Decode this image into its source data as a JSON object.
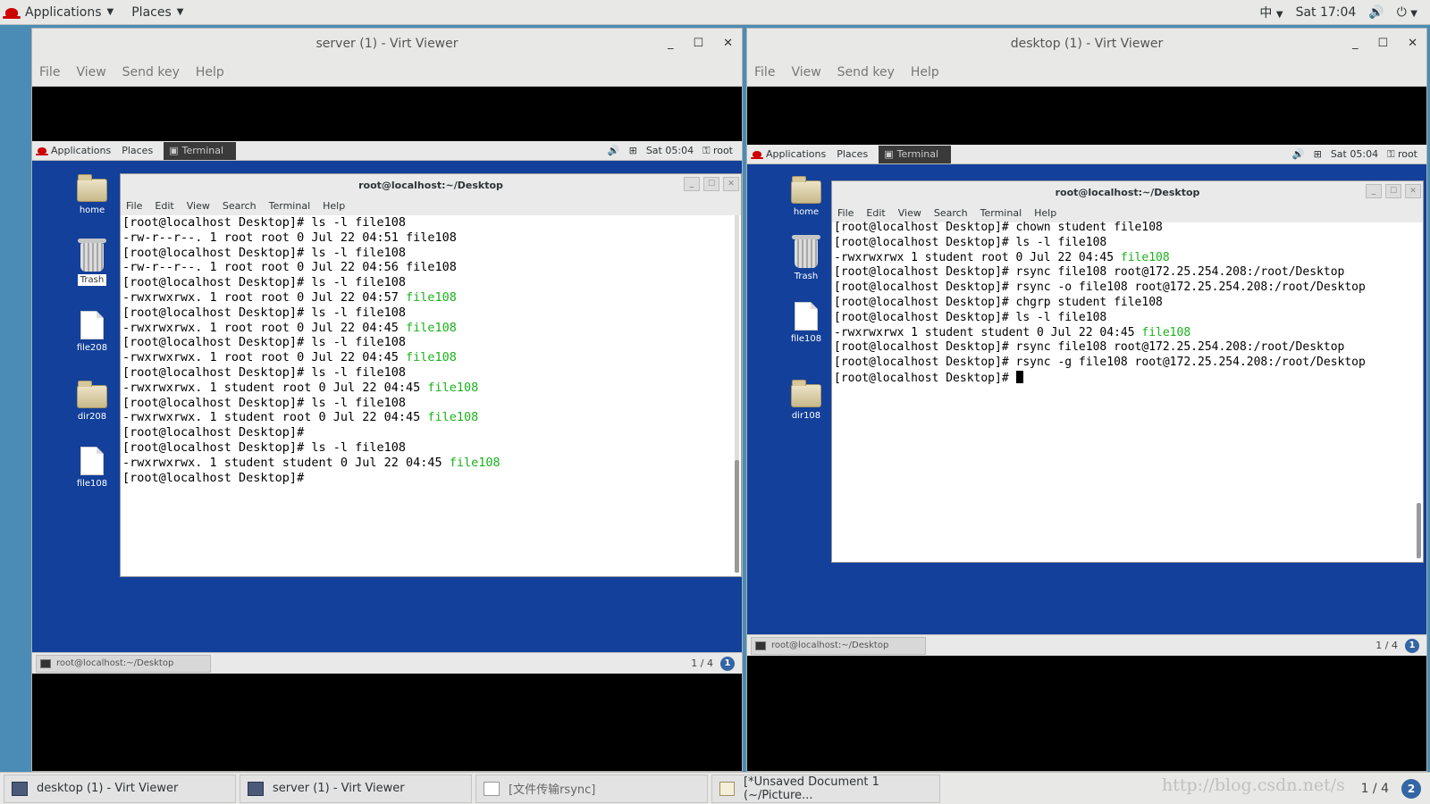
{
  "host_topbar": {
    "applications": "Applications",
    "places": "Places",
    "input_method": "中",
    "clock": "Sat 17:04"
  },
  "windows": [
    {
      "title": "server (1) - Virt Viewer",
      "menu": [
        "File",
        "View",
        "Send key",
        "Help"
      ],
      "guest": {
        "topbar": {
          "applications": "Applications",
          "places": "Places",
          "terminal_task": "Terminal",
          "clock": "Sat 05:04",
          "user": "root"
        },
        "desktop_icons": [
          "home",
          "Trash",
          "file208",
          "dir208",
          "file108"
        ],
        "terminal": {
          "title": "root@localhost:~/Desktop",
          "menu": [
            "File",
            "Edit",
            "View",
            "Search",
            "Terminal",
            "Help"
          ],
          "lines": [
            {
              "text": "[root@localhost Desktop]# ls -l file108",
              "hl": ""
            },
            {
              "text": "-rw-r--r--. 1 root root 0 Jul 22 04:51 file108",
              "hl": ""
            },
            {
              "text": "[root@localhost Desktop]# ls -l file108",
              "hl": ""
            },
            {
              "text": "-rw-r--r--. 1 root root 0 Jul 22 04:56 file108",
              "hl": ""
            },
            {
              "text": "[root@localhost Desktop]# ls -l file108",
              "hl": ""
            },
            {
              "text": "-rwxrwxrwx. 1 root root 0 Jul 22 04:57 ",
              "hl": "file108"
            },
            {
              "text": "[root@localhost Desktop]# ls -l file108",
              "hl": ""
            },
            {
              "text": "-rwxrwxrwx. 1 root root 0 Jul 22 04:45 ",
              "hl": "file108"
            },
            {
              "text": "[root@localhost Desktop]# ls -l file108",
              "hl": ""
            },
            {
              "text": "-rwxrwxrwx. 1 root root 0 Jul 22 04:45 ",
              "hl": "file108"
            },
            {
              "text": "[root@localhost Desktop]# ls -l file108",
              "hl": ""
            },
            {
              "text": "-rwxrwxrwx. 1 student root 0 Jul 22 04:45 ",
              "hl": "file108"
            },
            {
              "text": "[root@localhost Desktop]# ls -l file108",
              "hl": ""
            },
            {
              "text": "-rwxrwxrwx. 1 student root 0 Jul 22 04:45 ",
              "hl": "file108"
            },
            {
              "text": "[root@localhost Desktop]#",
              "hl": ""
            },
            {
              "text": "[root@localhost Desktop]# ls -l file108",
              "hl": ""
            },
            {
              "text": "-rwxrwxrwx. 1 student student 0 Jul 22 04:45 ",
              "hl": "file108"
            },
            {
              "text": "[root@localhost Desktop]# ",
              "hl": ""
            }
          ],
          "cursor": false
        },
        "bottom": {
          "task": "root@localhost:~/Desktop",
          "pager": "1 / 4"
        }
      }
    },
    {
      "title": "desktop (1) - Virt Viewer",
      "menu": [
        "File",
        "View",
        "Send key",
        "Help"
      ],
      "guest": {
        "topbar": {
          "applications": "Applications",
          "places": "Places",
          "terminal_task": "Terminal",
          "clock": "Sat 05:04",
          "user": "root"
        },
        "desktop_icons": [
          "home",
          "Trash",
          "file108",
          "dir108"
        ],
        "terminal": {
          "title": "root@localhost:~/Desktop",
          "menu": [
            "File",
            "Edit",
            "View",
            "Search",
            "Terminal",
            "Help"
          ],
          "lines": [
            {
              "text": "[root@localhost Desktop]# chown student file108",
              "hl": ""
            },
            {
              "text": "[root@localhost Desktop]# ls -l file108",
              "hl": ""
            },
            {
              "text": "-rwxrwxrwx 1 student root 0 Jul 22 04:45 ",
              "hl": "file108"
            },
            {
              "text": "[root@localhost Desktop]# rsync file108 root@172.25.254.208:/root/Desktop",
              "hl": ""
            },
            {
              "text": "[root@localhost Desktop]# rsync -o file108 root@172.25.254.208:/root/Desktop",
              "hl": ""
            },
            {
              "text": "[root@localhost Desktop]# chgrp student file108",
              "hl": ""
            },
            {
              "text": "[root@localhost Desktop]# ls -l file108",
              "hl": ""
            },
            {
              "text": "-rwxrwxrwx 1 student student 0 Jul 22 04:45 ",
              "hl": "file108"
            },
            {
              "text": "[root@localhost Desktop]# rsync file108 root@172.25.254.208:/root/Desktop",
              "hl": ""
            },
            {
              "text": "[root@localhost Desktop]# rsync -g file108 root@172.25.254.208:/root/Desktop",
              "hl": ""
            },
            {
              "text": "[root@localhost Desktop]# ",
              "hl": ""
            }
          ],
          "cursor": true
        },
        "bottom": {
          "task": "root@localhost:~/Desktop",
          "pager": "1 / 4"
        }
      }
    }
  ],
  "host_taskbar": {
    "tasks": [
      "desktop (1) - Virt Viewer",
      "server (1) - Virt Viewer",
      "[文件传输rsync]",
      "[*Unsaved Document 1 (~/Picture..."
    ],
    "pager": "1 / 4",
    "watermark": "http://blog.csdn.net/s"
  }
}
